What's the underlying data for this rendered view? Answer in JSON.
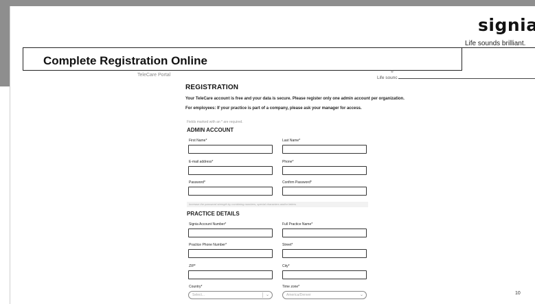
{
  "logo": {
    "text": "signia",
    "tagline": "Life sounds brilliant."
  },
  "slide_title": "Complete Registration Online",
  "portal": {
    "label": "TeleCare Portal",
    "inner_tagline": "Life sounc",
    "inner_mark": "®"
  },
  "form": {
    "title": "REGISTRATION",
    "intro_line1": "Your TeleCare account is free and your data is secure. Please register only one admin account per organization.",
    "intro_line2": "For employees: If your practice is part of a company, please ask your manager for access.",
    "required_note": "Fields marked with an * are required.",
    "admin_section": "ADMIN ACCOUNT",
    "first_name": "First Name*",
    "last_name": "Last Name*",
    "email": "E-mail address*",
    "phone": "Phone*",
    "password": "Password*",
    "confirm_password": "Confirm Password*",
    "password_hint": "Increase the password strength by combining numbers, special characters and/or letters",
    "practice_section": "PRACTICE DETAILS",
    "account_number": "Signia Account Number*",
    "practice_name": "Full Practice Name*",
    "practice_phone": "Practice Phone Number*",
    "street": "Street*",
    "zip": "ZIP*",
    "city": "City*",
    "country": "Country*",
    "timezone": "Time zone*",
    "country_value": "Select...",
    "timezone_value": "America/Denver"
  },
  "page_number": "10"
}
